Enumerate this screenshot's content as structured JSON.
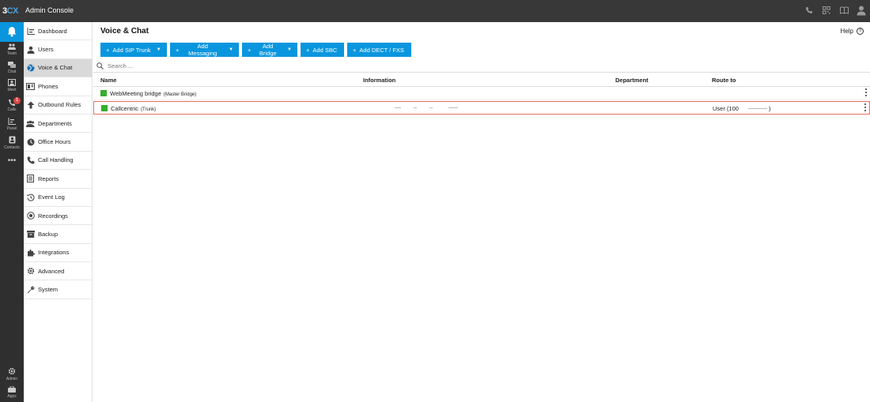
{
  "app": {
    "logo_a": "3",
    "logo_b": "CX",
    "title": "Admin Console"
  },
  "topbar_icons": [
    "phone-icon",
    "qr-icon",
    "book-icon",
    "user-icon"
  ],
  "rail": {
    "items": [
      {
        "label": "Team"
      },
      {
        "label": "Chat"
      },
      {
        "label": "Meet"
      },
      {
        "label": "Calls",
        "badge": "1"
      },
      {
        "label": "Panel"
      },
      {
        "label": "Contacts"
      },
      {
        "label": "Admin"
      },
      {
        "label": "Apps"
      }
    ]
  },
  "sidebar": {
    "items": [
      {
        "label": "Dashboard"
      },
      {
        "label": "Users"
      },
      {
        "label": "Voice & Chat"
      },
      {
        "label": "Phones"
      },
      {
        "label": "Outbound Rules"
      },
      {
        "label": "Departments"
      },
      {
        "label": "Office Hours"
      },
      {
        "label": "Call Handling"
      },
      {
        "label": "Reports"
      },
      {
        "label": "Event Log"
      },
      {
        "label": "Recordings"
      },
      {
        "label": "Backup"
      },
      {
        "label": "Integrations"
      },
      {
        "label": "Advanced"
      },
      {
        "label": "System"
      }
    ],
    "active": "Voice & Chat"
  },
  "page": {
    "title": "Voice & Chat",
    "help": "Help"
  },
  "toolbar": {
    "add_sip_trunk": "Add SIP Trunk",
    "add_messaging": "Add Messaging",
    "add_bridge": "Add Bridge",
    "add_sbc": "Add SBC",
    "add_dect": "Add DECT / FXS"
  },
  "search": {
    "placeholder": "Search ..."
  },
  "table": {
    "columns": {
      "name": "Name",
      "information": "Information",
      "department": "Department",
      "route_to": "Route to"
    },
    "rows": [
      {
        "name": "WebMeeting bridge",
        "tag": "(Master Bridge)",
        "route": ""
      },
      {
        "name": "Callcentric",
        "tag": "(Trunk)",
        "route_prefix": "User",
        "route_open": "(100",
        "route_close": ")"
      }
    ]
  },
  "colors": {
    "accent": "#0a96de",
    "status_ok": "#35ad2e",
    "topbar": "#383838",
    "selected_row_border": "#e87060"
  }
}
